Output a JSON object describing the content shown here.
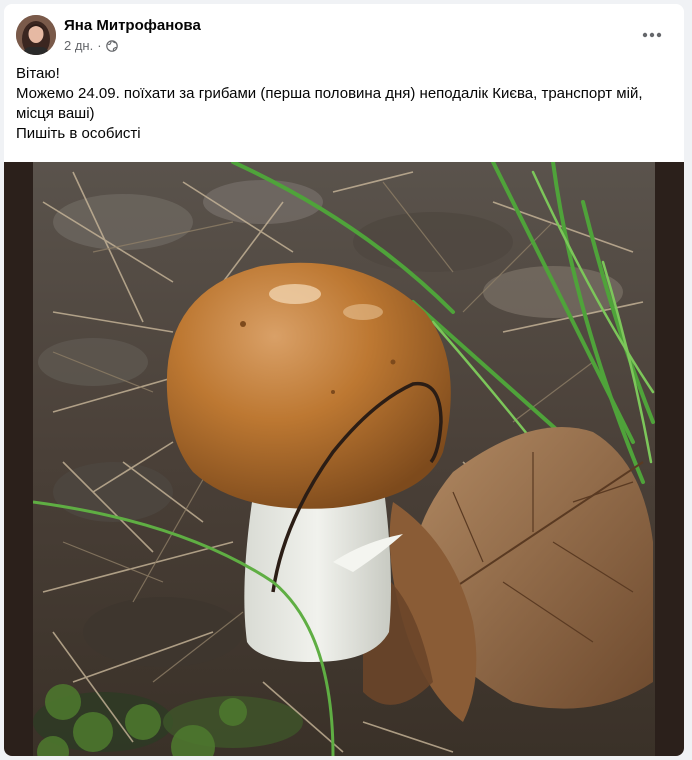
{
  "post": {
    "author_name": "Яна Митрофанова",
    "timestamp": "2 дн.",
    "separator": "·",
    "privacy_icon": "globe-icon",
    "more_icon": "more-options-icon",
    "text_lines": [
      "Вітаю!",
      "Можемо 24.09. поїхати за грибами (перша половина дня) неподалік Києва, транспорт мій, місця ваші)",
      "Пишіть в особисті"
    ],
    "photo_subject": "mushroom-photo"
  },
  "colors": {
    "text_primary": "#050505",
    "text_secondary": "#65676b",
    "page_background": "#f0f2f5",
    "photo_background": "#2b201b"
  }
}
